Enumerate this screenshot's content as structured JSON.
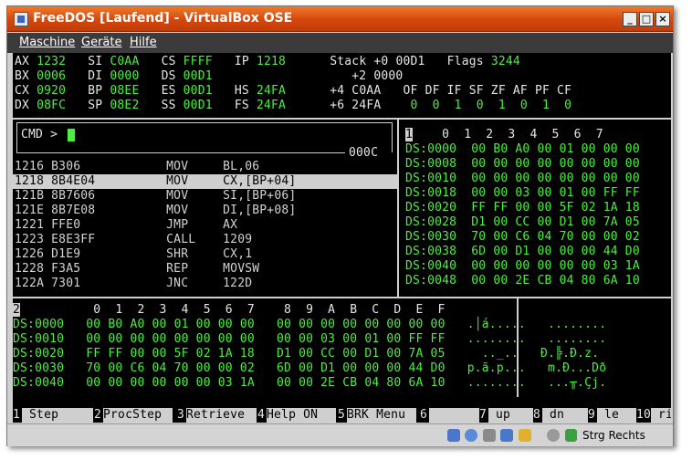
{
  "window": {
    "title": "FreeDOS [Laufend] - VirtualBox OSE",
    "min_icon": "minimize-icon",
    "max_icon": "maximize-icon",
    "close_icon": "close-icon"
  },
  "menubar": {
    "items": [
      "Maschine",
      "Geräte",
      "Hilfe"
    ]
  },
  "registers": [
    {
      "pre": "AX ",
      "val": "1232",
      "m1": "   SI ",
      "v1": "C0AA",
      "m2": "   CS ",
      "v2": "FFFF",
      "m3": "   IP ",
      "v3": "1218",
      "stk": "      Stack +0 00D1",
      "fl": "   Flags ",
      "fv": "3244"
    },
    {
      "pre": "BX ",
      "val": "0006",
      "m1": "   DI ",
      "v1": "0000",
      "m2": "   DS ",
      "v2": "00D1",
      "m3": "",
      "v3": "",
      "stk": "                   +2 0000",
      "fl": "",
      "fv": ""
    },
    {
      "pre": "CX ",
      "val": "0920",
      "m1": "   BP ",
      "v1": "08EE",
      "m2": "   ES ",
      "v2": "00D1",
      "m3": "   HS ",
      "v3": "24FA",
      "stk": "      +4 C0AA",
      "fl": "   OF DF IF SF ZF AF PF CF",
      "fv": ""
    },
    {
      "pre": "DX ",
      "val": "08FC",
      "m1": "   SP ",
      "v1": "08E2",
      "m2": "   SS ",
      "v2": "00D1",
      "m3": "   FS ",
      "v3": "24FA",
      "stk": "      +6 24FA",
      "fl": "    0  0  1  0  1  0  1  0",
      "fv": ""
    }
  ],
  "cmd": {
    "prompt": "CMD >",
    "addr_tag": "000C"
  },
  "disasm": [
    {
      "addr": "1216",
      "bytes": "B306",
      "op": "MOV",
      "args": "BL,06"
    },
    {
      "addr": "1218",
      "bytes": "8B4E04",
      "op": "MOV",
      "args": "CX,[BP+04]"
    },
    {
      "addr": "121B",
      "bytes": "8B7606",
      "op": "MOV",
      "args": "SI,[BP+06]"
    },
    {
      "addr": "121E",
      "bytes": "8B7E08",
      "op": "MOV",
      "args": "DI,[BP+08]"
    },
    {
      "addr": "1221",
      "bytes": "FFE0",
      "op": "JMP",
      "args": "AX"
    },
    {
      "addr": "1223",
      "bytes": "E8E3FF",
      "op": "CALL",
      "args": "1209"
    },
    {
      "addr": "1226",
      "bytes": "D1E9",
      "op": "SHR",
      "args": "CX,1"
    },
    {
      "addr": "1228",
      "bytes": "F3A5",
      "op": "REP",
      "args": "MOVSW"
    },
    {
      "addr": "122A",
      "bytes": "7301",
      "op": "JNC",
      "args": "122D"
    }
  ],
  "dump1": {
    "num": "1",
    "header": "    0  1  2  3  4  5  6  7",
    "rows": [
      {
        "a": "DS:0000",
        "b": "00 B0 A0 00 01 00 00 00"
      },
      {
        "a": "DS:0008",
        "b": "00 00 00 00 00 00 00 00"
      },
      {
        "a": "DS:0010",
        "b": "00 00 00 00 00 00 00 00"
      },
      {
        "a": "DS:0018",
        "b": "00 00 03 00 01 00 FF FF"
      },
      {
        "a": "DS:0020",
        "b": "FF FF 00 00 5F 02 1A 18"
      },
      {
        "a": "DS:0028",
        "b": "D1 00 CC 00 D1 00 7A 05"
      },
      {
        "a": "DS:0030",
        "b": "70 00 C6 04 70 00 00 02"
      },
      {
        "a": "DS:0038",
        "b": "6D 00 D1 00 00 00 44 D0"
      },
      {
        "a": "DS:0040",
        "b": "00 00 00 00 00 00 03 1A"
      },
      {
        "a": "DS:0048",
        "b": "00 00 2E CB 04 80 6A 10"
      }
    ]
  },
  "dump2": {
    "num": "2",
    "header": "          0  1  2  3  4  5  6  7    8  9  A  B  C  D  E  F",
    "rows": [
      {
        "a": "DS:0000",
        "b": "00 B0 A0 00 01 00 00 00",
        "c": "00 00 00 00 00 00 00 00",
        "t1": " .│á.....",
        "t2": "   ........"
      },
      {
        "a": "DS:0010",
        "b": "00 00 00 00 00 00 00 00",
        "c": "00 00 03 00 01 00 FF FF",
        "t1": " ........",
        "t2": "   ........"
      },
      {
        "a": "DS:0020",
        "b": "FF FF 00 00 5F 02 1A 18",
        "c": "D1 00 CC 00 D1 00 7A 05",
        "t1": "   .._..",
        "t2": "   Ð.╠.Ð.z."
      },
      {
        "a": "DS:0030",
        "b": "70 00 C6 04 70 00 00 02",
        "c": "6D 00 D1 00 00 00 44 D0",
        "t1": " p.ã.p...",
        "t2": "   m.Ð...Dð"
      },
      {
        "a": "DS:0040",
        "b": "00 00 00 00 00 00 03 1A",
        "c": "00 00 2E CB 04 80 6A 10",
        "t1": " ........",
        "t2": "   ...╥.Çj."
      }
    ]
  },
  "fkeys": [
    {
      "n": "1",
      "label": " Step     "
    },
    {
      "n": "2",
      "label": "ProcStep"
    },
    {
      "n": "3",
      "label": "Retrieve "
    },
    {
      "n": "4",
      "label": "Help ON  "
    },
    {
      "n": "5",
      "label": "BRK Menu "
    },
    {
      "n": "6",
      "label": "       "
    },
    {
      "n": "7",
      "label": " up  "
    },
    {
      "n": "8",
      "label": " dn  "
    },
    {
      "n": "9",
      "label": " le "
    },
    {
      "n": "10",
      "label": " ri "
    }
  ],
  "statusbar": {
    "host_key": "Strg Rechts"
  }
}
